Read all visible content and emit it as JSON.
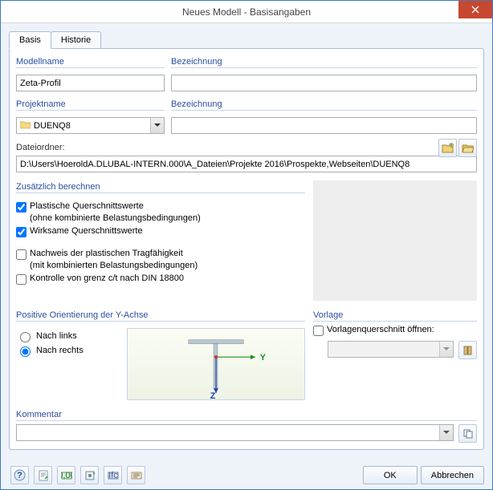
{
  "window": {
    "title": "Neues Modell - Basisangaben"
  },
  "tabs": {
    "basis": "Basis",
    "historie": "Historie"
  },
  "labels": {
    "modellname": "Modellname",
    "bezeichnung1": "Bezeichnung",
    "projektname": "Projektname",
    "bezeichnung2": "Bezeichnung",
    "dateiordner": "Dateiordner:",
    "zusaetzlich": "Zusätzlich berechnen",
    "yachse": "Positive Orientierung der Y-Achse",
    "vorlage": "Vorlage",
    "kommentar": "Kommentar"
  },
  "model": {
    "name": "Zeta-Profil",
    "bezeichnung": ""
  },
  "project": {
    "name": "DUENQ8",
    "bezeichnung": "",
    "folder": "D:\\Users\\HoeroldA.DLUBAL-INTERN.000\\A_Dateien\\Projekte 2016\\Prospekte,Webseiten\\DUENQ8"
  },
  "calc": {
    "plastisch_label": "Plastische Querschnittswerte",
    "plastisch_sub": "(ohne kombinierte Belastungsbedingungen)",
    "wirksam_label": "Wirksame Querschnittswerte",
    "nachweis_label": "Nachweis der plastischen Tragfähigkeit",
    "nachweis_sub": "(mit kombinierten Belastungsbedingungen)",
    "kontrolle_label": "Kontrolle von grenz c/t nach DIN 18800"
  },
  "orient": {
    "links": "Nach links",
    "rechts": "Nach rechts"
  },
  "axis": {
    "y": "Y",
    "z": "Z"
  },
  "vorlage_check": "Vorlagenquerschnitt öffnen:",
  "buttons": {
    "ok": "OK",
    "cancel": "Abbrechen"
  },
  "icons": {
    "new_folder": "new-folder-icon",
    "open_folder": "open-folder-icon",
    "help": "help-icon",
    "note": "note-icon",
    "units1": "units-icon",
    "units2": "settings-icon",
    "units3": "ifc-icon",
    "units4": "options-icon",
    "copy": "copy-icon",
    "lib": "library-icon"
  }
}
